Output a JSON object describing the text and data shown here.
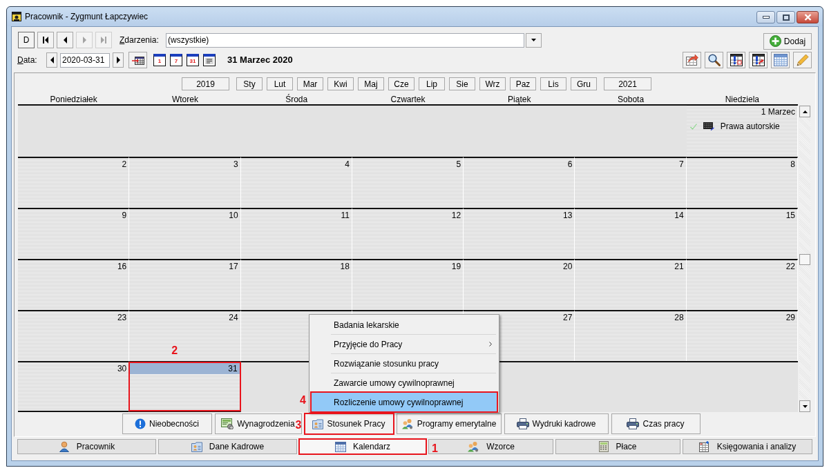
{
  "window": {
    "title": "Pracownik - Zygmunt Łapczywiec"
  },
  "toolbar": {
    "nav_buttons": [
      {
        "kind": "text",
        "label": "D",
        "disabled": false
      },
      {
        "kind": "first",
        "disabled": false
      },
      {
        "kind": "previous",
        "disabled": false
      },
      {
        "kind": "next",
        "disabled": true
      },
      {
        "kind": "last",
        "disabled": true
      }
    ],
    "events_filter": {
      "label": "Zdarzenia:",
      "value": "(wszystkie)"
    },
    "add_button": {
      "label": "Dodaj"
    },
    "date": {
      "label": "Data:",
      "value": "2020-03-31"
    },
    "view_buttons": [
      {
        "kind": "day",
        "label": "1"
      },
      {
        "kind": "week",
        "label": "7"
      },
      {
        "kind": "month",
        "label": "31"
      },
      {
        "kind": "list"
      }
    ],
    "date_caption": "31 Marzec 2020"
  },
  "calendar": {
    "previous_year": "2019",
    "months": [
      "Sty",
      "Lut",
      "Mar",
      "Kwi",
      "Maj",
      "Cze",
      "Lip",
      "Sie",
      "Wrz",
      "Paz",
      "Lis",
      "Gru"
    ],
    "next_year": "2021",
    "weekdays": [
      "Poniedziałek",
      "Wtorek",
      "Środa",
      "Czwartek",
      "Piątek",
      "Sobota",
      "Niedziela"
    ],
    "weeks": [
      [
        {
          "kind": "outside"
        },
        {
          "kind": "outside"
        },
        {
          "kind": "outside"
        },
        {
          "kind": "outside"
        },
        {
          "kind": "outside"
        },
        {
          "kind": "outside"
        },
        {
          "kind": "day",
          "day": "1 Marzec",
          "selected": false,
          "events": [
            {
              "title": "Prawa autorskie"
            }
          ]
        }
      ],
      [
        {
          "kind": "day",
          "day": "2",
          "selected": false
        },
        {
          "kind": "day",
          "day": "3",
          "selected": false
        },
        {
          "kind": "day",
          "day": "4",
          "selected": false
        },
        {
          "kind": "day",
          "day": "5",
          "selected": false
        },
        {
          "kind": "day",
          "day": "6",
          "selected": false
        },
        {
          "kind": "day",
          "day": "7",
          "selected": false
        },
        {
          "kind": "day",
          "day": "8",
          "selected": false
        }
      ],
      [
        {
          "kind": "day",
          "day": "9",
          "selected": false
        },
        {
          "kind": "day",
          "day": "10",
          "selected": false
        },
        {
          "kind": "day",
          "day": "11",
          "selected": false
        },
        {
          "kind": "day",
          "day": "12",
          "selected": false
        },
        {
          "kind": "day",
          "day": "13",
          "selected": false
        },
        {
          "kind": "day",
          "day": "14",
          "selected": false
        },
        {
          "kind": "day",
          "day": "15",
          "selected": false
        }
      ],
      [
        {
          "kind": "day",
          "day": "16",
          "selected": false
        },
        {
          "kind": "day",
          "day": "17",
          "selected": false
        },
        {
          "kind": "day",
          "day": "18",
          "selected": false
        },
        {
          "kind": "day",
          "day": "19",
          "selected": false
        },
        {
          "kind": "day",
          "day": "20",
          "selected": false
        },
        {
          "kind": "day",
          "day": "21",
          "selected": false
        },
        {
          "kind": "day",
          "day": "22",
          "selected": false
        }
      ],
      [
        {
          "kind": "day",
          "day": "23",
          "selected": false
        },
        {
          "kind": "day",
          "day": "24",
          "selected": false
        },
        {
          "kind": "day",
          "selected": false
        },
        {
          "kind": "day",
          "selected": false
        },
        {
          "kind": "day",
          "day": "27",
          "selected": false
        },
        {
          "kind": "day",
          "day": "28",
          "selected": false
        },
        {
          "kind": "day",
          "day": "29",
          "selected": false
        }
      ],
      [
        {
          "kind": "day",
          "day": "30",
          "selected": false
        },
        {
          "kind": "day",
          "day": "31",
          "selected": true,
          "annotation": "2"
        },
        {
          "kind": "outside"
        },
        {
          "kind": "outside"
        },
        {
          "kind": "outside"
        },
        {
          "kind": "outside"
        },
        {
          "kind": "outside"
        }
      ]
    ]
  },
  "context_menu": {
    "items": [
      {
        "label": "Badania lekarskie",
        "submenu": false,
        "selected": false
      },
      {
        "label": "Przyjęcie do Pracy",
        "submenu": true,
        "selected": false
      },
      {
        "label": "Rozwiązanie stosunku pracy",
        "submenu": false,
        "selected": false
      },
      {
        "label": "Zawarcie umowy cywilnoprawnej",
        "submenu": false,
        "selected": false
      },
      {
        "label": "Rozliczenie umowy cywilnoprawnej",
        "submenu": false,
        "selected": true,
        "annotation": "4"
      }
    ]
  },
  "subtabs": [
    {
      "label": "Nieobecności"
    },
    {
      "label": "Wynagrodzenia"
    },
    {
      "label": "Stosunek Pracy",
      "annotation": "3"
    },
    {
      "label": "Programy emerytalne"
    },
    {
      "label": "Wydruki kadrowe"
    },
    {
      "label": "Czas pracy"
    }
  ],
  "bottom_tabs": [
    {
      "label": "Pracownik",
      "selected": false
    },
    {
      "label": "Dane Kadrowe",
      "selected": false
    },
    {
      "label": "Kalendarz",
      "selected": true,
      "annotation": "1"
    },
    {
      "label": "Wzorce",
      "selected": false
    },
    {
      "label": "Płace",
      "selected": false
    },
    {
      "label": "Księgowania i analizy",
      "selected": false
    }
  ]
}
